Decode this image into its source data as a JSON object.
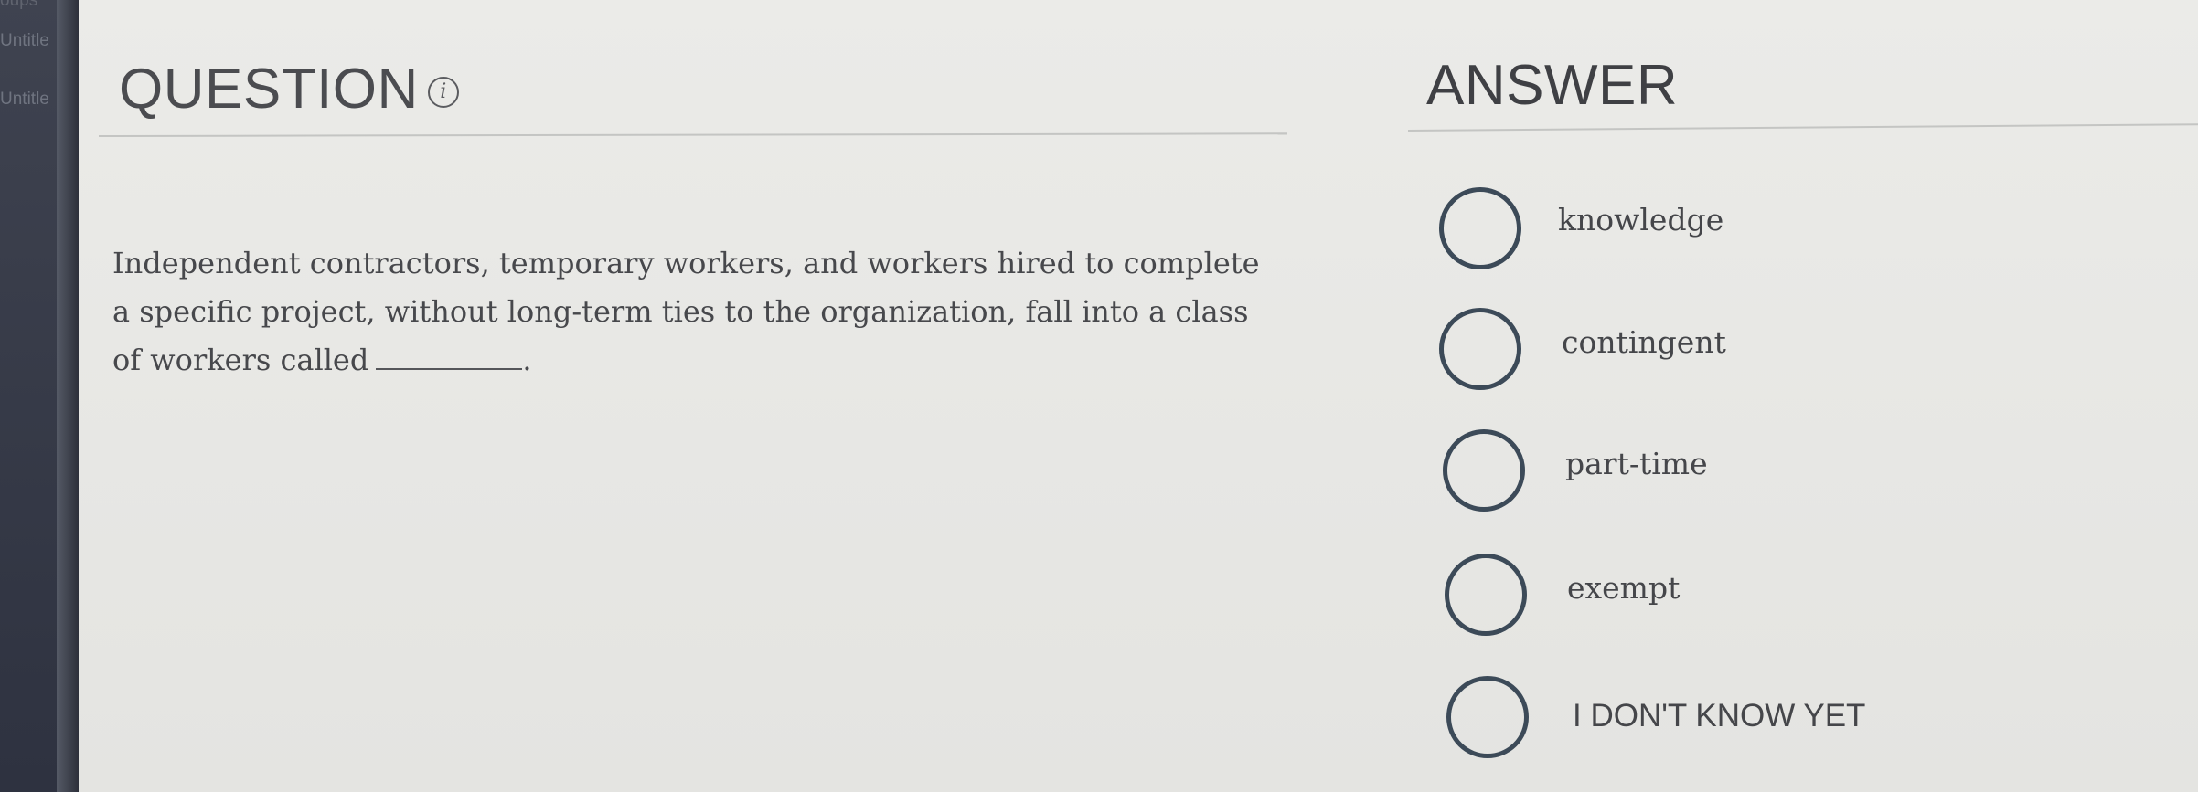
{
  "sidebar": {
    "tabs": [
      "Untitle",
      "Untitle"
    ],
    "top_fragment": "oups"
  },
  "question": {
    "heading": "QUESTION",
    "info_icon": "i",
    "text_before_blank": "Independent contractors, temporary workers, and workers hired to complete a specific project, without long-term ties to the organization, fall into a class of workers called",
    "text_after_blank": "."
  },
  "answer": {
    "heading": "ANSWER",
    "options": [
      {
        "label": "knowledge"
      },
      {
        "label": "contingent"
      },
      {
        "label": "part-time"
      },
      {
        "label": "exempt"
      },
      {
        "label": "I DON'T KNOW YET"
      }
    ]
  },
  "colors": {
    "background": "#e6e6e3",
    "sidebar": "#3a3e4a",
    "radio_border": "#3c4a58",
    "text": "#47484c"
  },
  "icons": {
    "info": "info-circle-icon",
    "radio": "radio-empty-icon"
  }
}
